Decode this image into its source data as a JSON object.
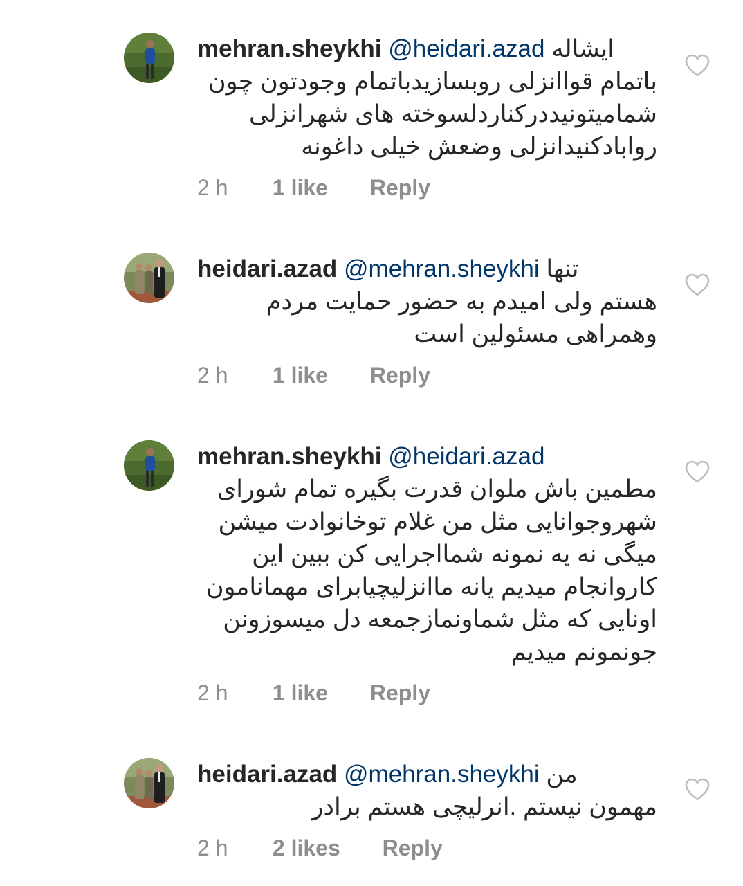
{
  "colors": {
    "text": "#262626",
    "mention": "#003569",
    "meta": "#8e8e8e",
    "heart_outline": "#bdbdbd"
  },
  "icons": {
    "like": "heart-outline-icon"
  },
  "comments": [
    {
      "username": "mehran.sheykhi",
      "mention": "@heidari.azad",
      "first_words": "ایشاله",
      "lines": [
        "باتمام قواانزلی روبسازیدباتمام وجودتون چون",
        "شمامیتونیددرکناردلسوخته های شهرانزلی",
        "روابادکنیدانزلی وضعش خیلی داغونه"
      ],
      "time": "2 h",
      "likes": "1 like",
      "reply": "Reply"
    },
    {
      "username": "heidari.azad",
      "mention": "@mehran.sheykhi",
      "first_words": "تنها",
      "lines": [
        "هستم ولی امیدم به حضور  حمایت مردم",
        "وهمراهی مسئولین است"
      ],
      "time": "2 h",
      "likes": "1 like",
      "reply": "Reply"
    },
    {
      "username": "mehran.sheykhi",
      "mention": "@heidari.azad",
      "first_words": "",
      "lines": [
        "مطمین باش ملوان قدرت بگیره تمام شورای",
        "شهروجوانایی مثل من غلام توخانوادت میشن",
        "میگی نه یه نمونه شمااجرایی کن ببین این",
        "کاروانجام میدیم یانه ماانزلیچیابرای مهمانامون",
        "اونایی که مثل شماونمازجمعه دل میسوزونن",
        "جونمونم میدیم"
      ],
      "time": "2 h",
      "likes": "1 like",
      "reply": "Reply"
    },
    {
      "username": "heidari.azad",
      "mention": "@mehran.sheykhi",
      "first_words": "من",
      "lines": [
        "مهمون نیستم .انرلیچی هستم برادر"
      ],
      "time": "2 h",
      "likes": "2 likes",
      "reply": "Reply"
    }
  ]
}
